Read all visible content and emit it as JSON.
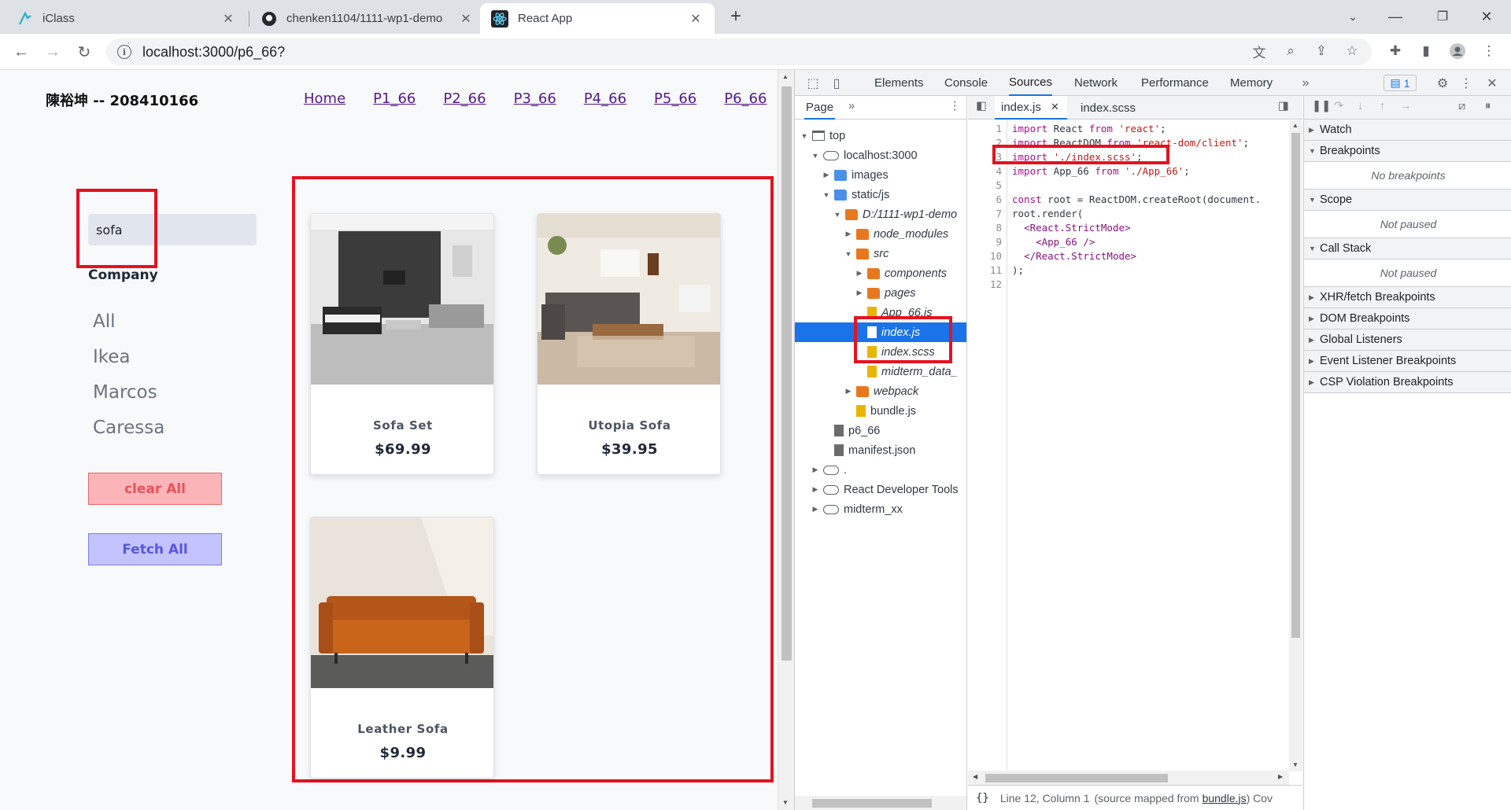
{
  "browser": {
    "tabs": [
      {
        "title": "iClass"
      },
      {
        "title": "chenken1104/1111-wp1-demo"
      },
      {
        "title": "React App"
      }
    ],
    "url": "localhost:3000/p6_66?"
  },
  "app": {
    "student": "陳裕坤 -- 208410166",
    "nav_links": [
      "Home",
      "P1_66",
      "P2_66",
      "P3_66",
      "P4_66",
      "P5_66",
      "P6_66"
    ],
    "search_value": "sofa",
    "company_title": "Company",
    "companies": [
      "All",
      "Ikea",
      "Marcos",
      "Caressa"
    ],
    "clear_label": "clear All",
    "fetch_label": "Fetch All",
    "products": [
      {
        "name": "Sofa Set",
        "price": "$69.99"
      },
      {
        "name": "Utopia Sofa",
        "price": "$39.95"
      },
      {
        "name": "Leather Sofa",
        "price": "$9.99"
      }
    ]
  },
  "devtools": {
    "tabs": [
      "Elements",
      "Console",
      "Sources",
      "Network",
      "Performance",
      "Memory"
    ],
    "active_tab": "Sources",
    "issues_count": "1",
    "navigator": {
      "tab": "Page",
      "tree": [
        "top",
        "localhost:3000",
        "images",
        "static/js",
        "D:/1111-wp1-demo",
        "node_modules",
        "src",
        "components",
        "pages",
        "App_66.js",
        "index.js",
        "index.scss",
        "midterm_data_",
        "webpack",
        "bundle.js",
        "p6_66",
        "manifest.json",
        ".",
        "React Developer Tools",
        "midterm_xx"
      ]
    },
    "editor": {
      "tabs": [
        "index.js",
        "index.scss"
      ],
      "line_numbers": [
        "1",
        "2",
        "3",
        "4",
        "5",
        "6",
        "7",
        "8",
        "9",
        "10",
        "11",
        "12"
      ],
      "status": "Line 12, Column 1",
      "status_mapped": "(source mapped from",
      "status_link": "bundle.js",
      "status_tail": ") Cov"
    },
    "debugger": {
      "sections": [
        "Watch",
        "Breakpoints",
        "Scope",
        "Call Stack",
        "XHR/fetch Breakpoints",
        "DOM Breakpoints",
        "Global Listeners",
        "Event Listener Breakpoints",
        "CSP Violation Breakpoints"
      ],
      "no_breakpoints": "No breakpoints",
      "not_paused": "Not paused"
    }
  },
  "colors": {
    "highlight_red": "#e3131f",
    "devtools_blue": "#1a73e8",
    "clear_bg": "#fbb4b8",
    "fetch_bg": "#c3c3ff"
  }
}
